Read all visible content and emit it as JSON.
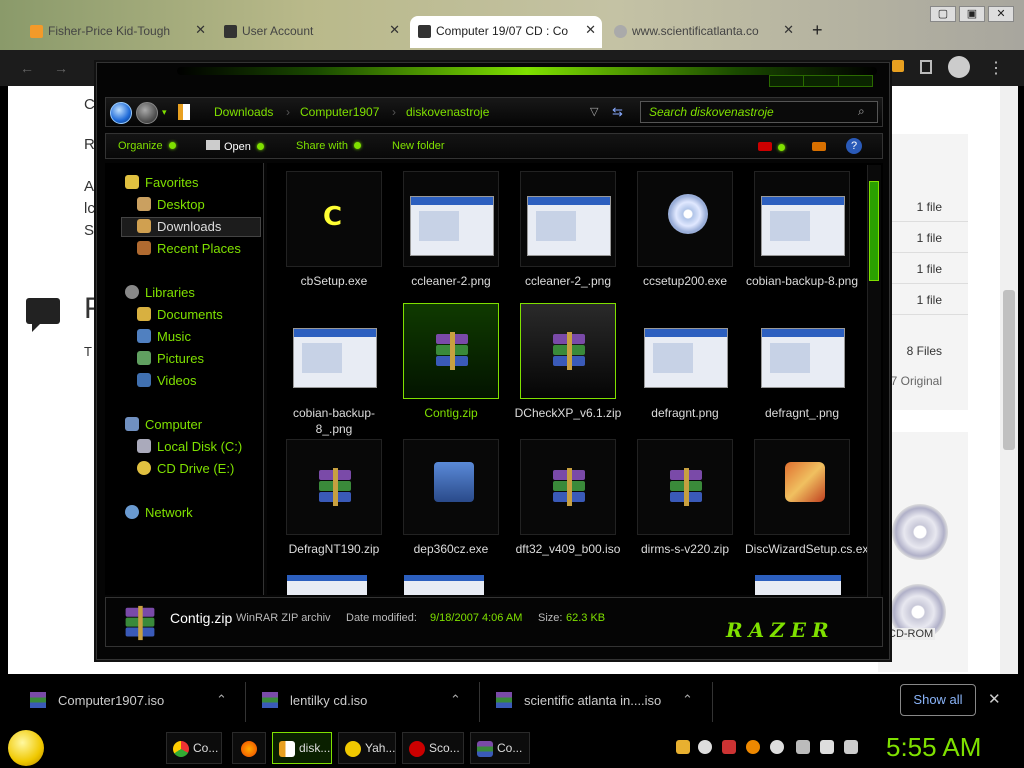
{
  "browser": {
    "tabs": [
      {
        "label": "Fisher-Price Kid-Tough",
        "active": false
      },
      {
        "label": "User Account",
        "active": false
      },
      {
        "label": "Computer 19/07 CD : Co",
        "active": true
      },
      {
        "label": "www.scientificatlanta.co",
        "active": false
      }
    ],
    "new_tab": "+",
    "window_controls": [
      "▢",
      "▣",
      "✕"
    ]
  },
  "page": {
    "left_text": [
      "C",
      "R",
      "A",
      "lc",
      "S",
      "F",
      "T"
    ],
    "right_rows": [
      "1 file",
      "1 file",
      "1 file",
      "1 file"
    ],
    "summary_files": "8 Files",
    "summary_original": "7 Original",
    "cd_rom": "CD-ROM"
  },
  "explorer": {
    "breadcrumb": [
      "Downloads",
      "Computer1907",
      "diskovenastroje"
    ],
    "search_placeholder": "Search diskovenastroje",
    "toolbar": {
      "organize": "Organize",
      "open": "Open",
      "share": "Share with",
      "new_folder": "New folder",
      "help": "?"
    },
    "sidebar": {
      "favorites": "Favorites",
      "desktop": "Desktop",
      "downloads": "Downloads",
      "recent": "Recent Places",
      "libraries": "Libraries",
      "documents": "Documents",
      "music": "Music",
      "pictures": "Pictures",
      "videos": "Videos",
      "computer": "Computer",
      "local_disk": "Local Disk (C:)",
      "cd_drive": "CD Drive (E:)",
      "network": "Network"
    },
    "files": [
      {
        "name": "cbSetup.exe",
        "icon": "c-app-icon"
      },
      {
        "name": "ccleaner-2.png",
        "icon": "screenshot-thumb"
      },
      {
        "name": "ccleaner-2_.png",
        "icon": "screenshot-thumb"
      },
      {
        "name": "ccsetup200.exe",
        "icon": "setup-cd-icon"
      },
      {
        "name": "cobian-backup-8.png",
        "icon": "screenshot-thumb"
      },
      {
        "name": "cobian-backup-8_.png",
        "icon": "screenshot-thumb"
      },
      {
        "name": "Contig.zip",
        "icon": "winrar-icon"
      },
      {
        "name": "DCheckXP_v6.1.zip",
        "icon": "winrar-icon"
      },
      {
        "name": "defragnt.png",
        "icon": "screenshot-thumb"
      },
      {
        "name": "defragnt_.png",
        "icon": "screenshot-thumb"
      },
      {
        "name": "DefragNT190.zip",
        "icon": "winrar-icon"
      },
      {
        "name": "dep360cz.exe",
        "icon": "installer-icon"
      },
      {
        "name": "dft32_v409_b00.iso",
        "icon": "winrar-icon"
      },
      {
        "name": "dirms-s-v220.zip",
        "icon": "winrar-icon"
      },
      {
        "name": "DiscWizardSetup.cs.exe",
        "icon": "wizard-icon"
      }
    ],
    "status": {
      "name": "Contig.zip",
      "type": "WinRAR ZIP archiv",
      "modified_label": "Date modified:",
      "modified": "9/18/2007 4:06 AM",
      "size_label": "Size:",
      "size": "62.3 KB",
      "brand": "RAZER"
    }
  },
  "downloads_bar": {
    "items": [
      "Computer1907.iso",
      "lentilky cd.iso",
      "scientific atlanta in....iso"
    ],
    "show_all": "Show all",
    "close": "✕"
  },
  "taskbar": {
    "buttons": [
      "Co...",
      "",
      "disk...",
      "Yah...",
      "Sco...",
      "Co..."
    ],
    "clock": "5:55 AM"
  },
  "colors": {
    "accent": "#7fe000",
    "background": "#000000"
  }
}
